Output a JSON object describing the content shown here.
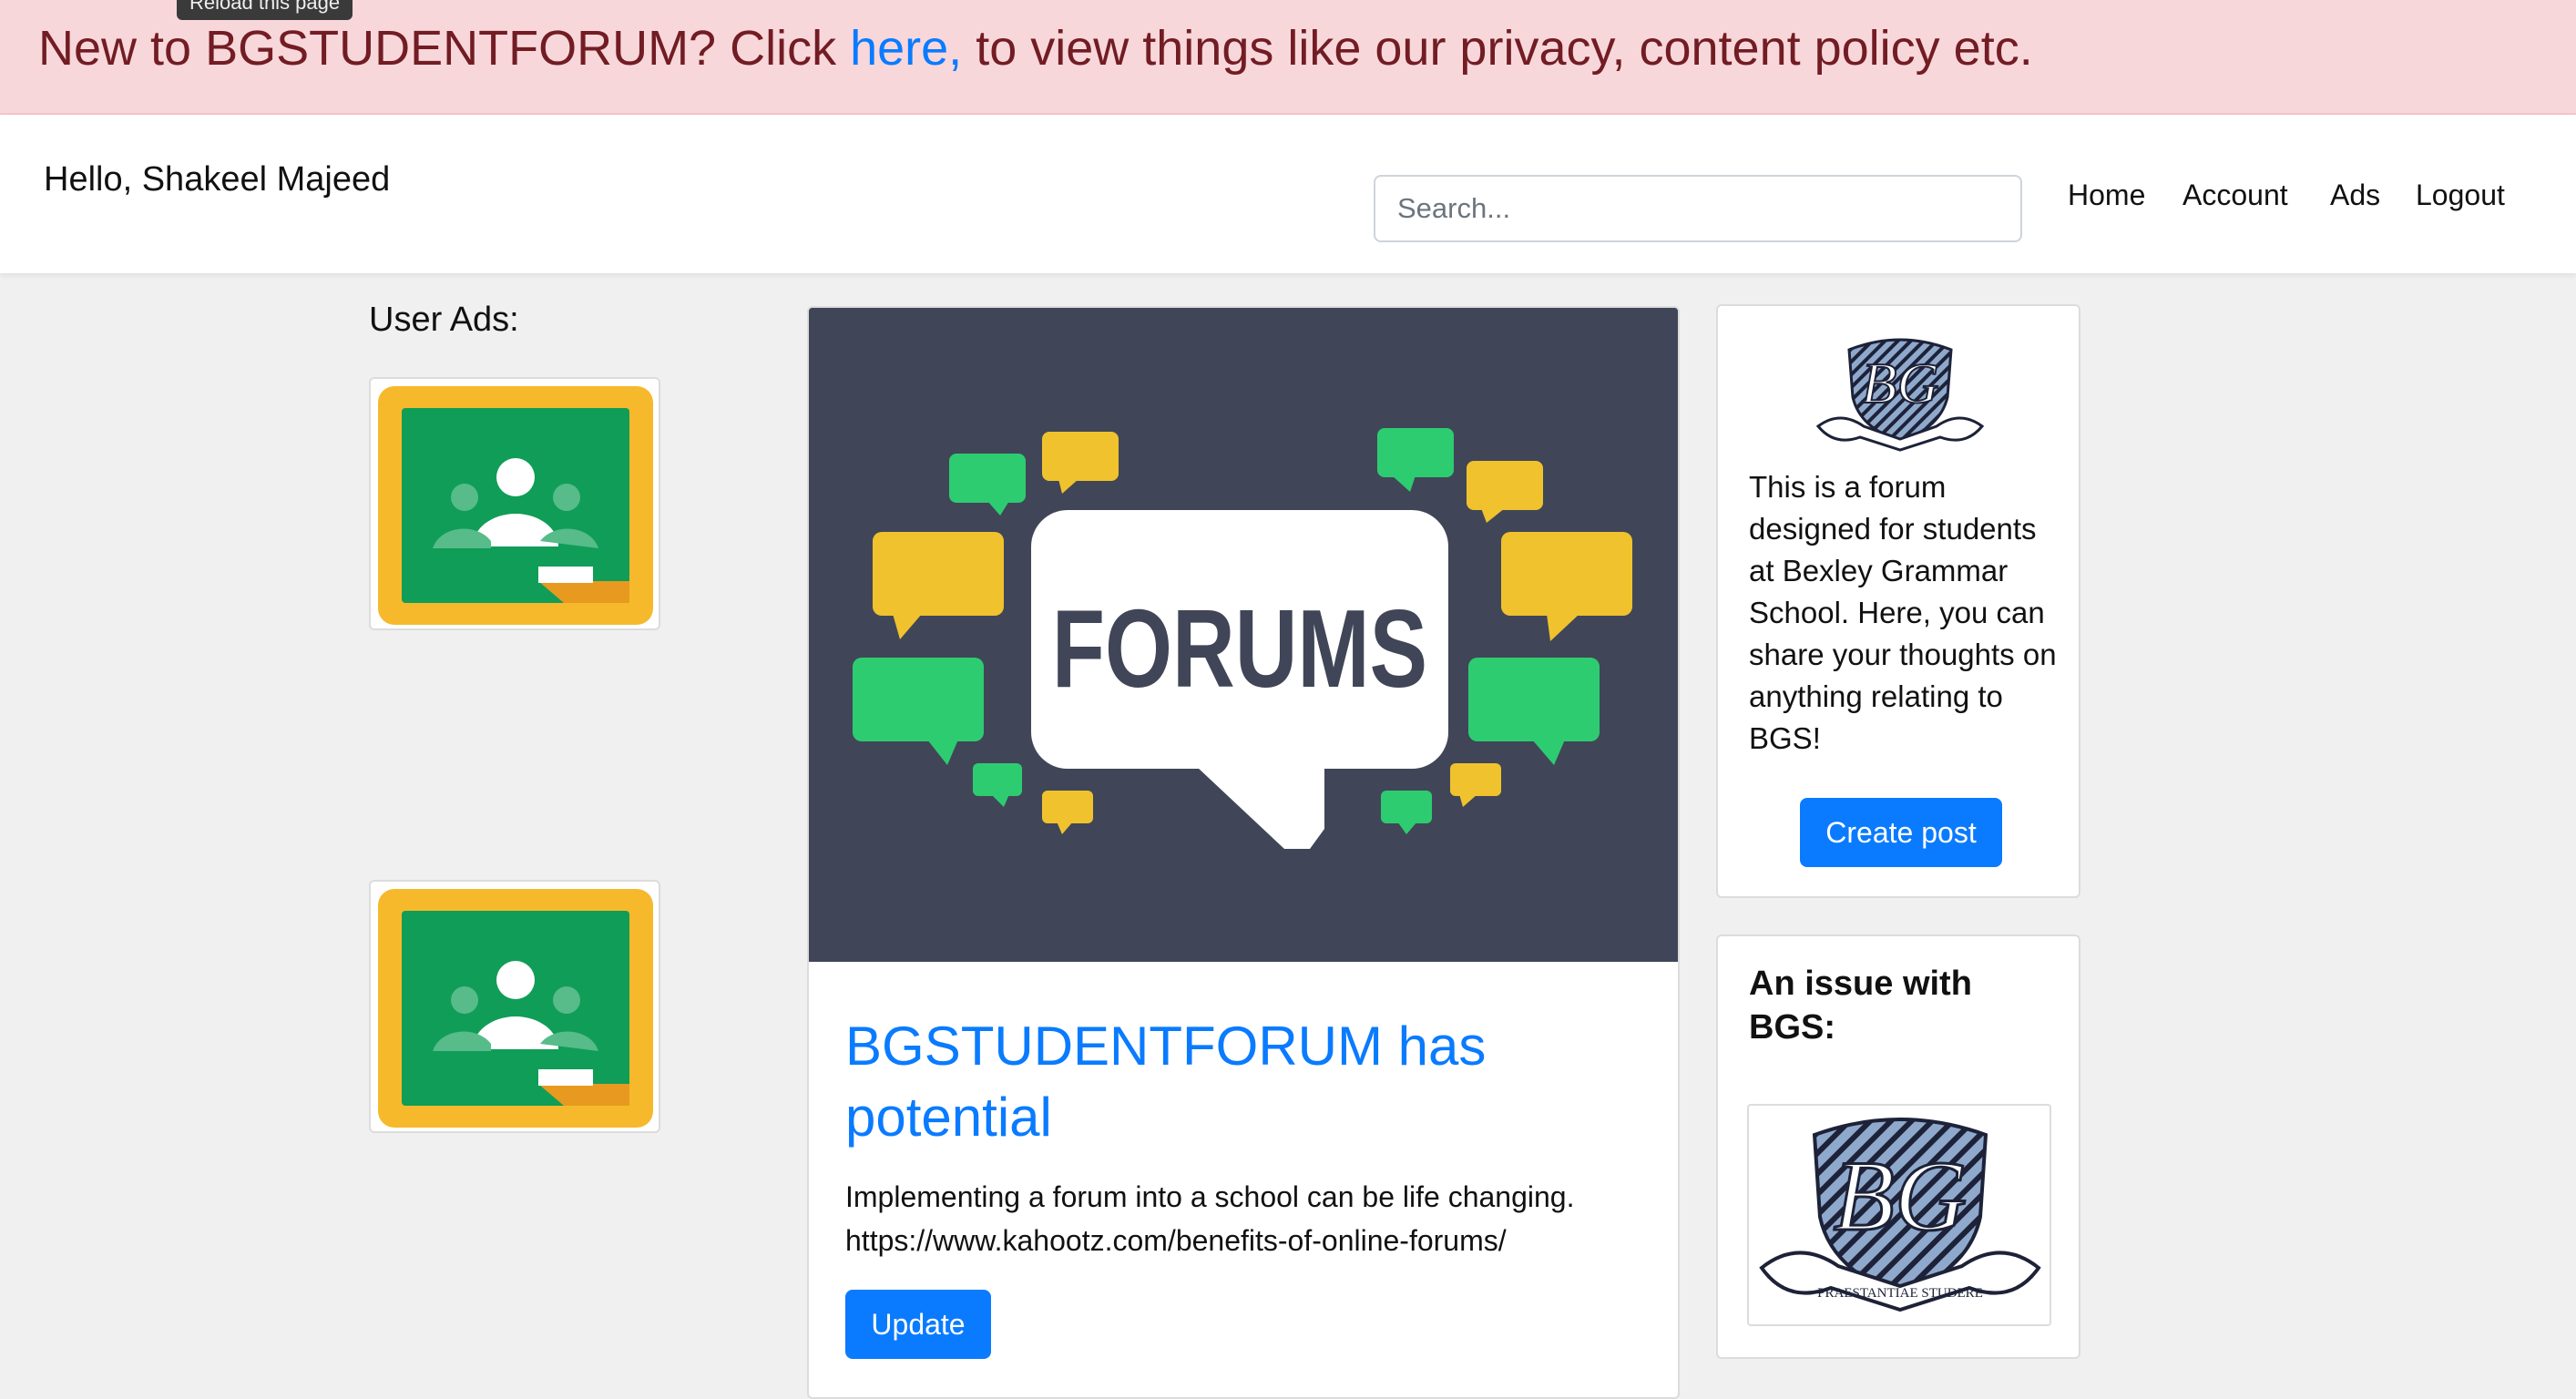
{
  "tooltip": "Reload this page",
  "alert": {
    "prefix": "New to BGSTUDENTFORUM? Click ",
    "link": "here,",
    "suffix": " to view things like our privacy, content policy etc."
  },
  "navbar": {
    "greeting": "Hello, Shakeel Majeed",
    "search_placeholder": "Search...",
    "links": [
      "Home",
      "Account",
      "Ads",
      "Logout"
    ]
  },
  "ads": {
    "title": "User Ads:",
    "items": [
      {
        "icon": "google-classroom-icon"
      },
      {
        "icon": "google-classroom-icon"
      }
    ]
  },
  "post": {
    "image_text": "FORUMS",
    "title": "BGSTUDENTFORUM has potential",
    "body_line1": "Implementing a forum into a school can be life changing.",
    "body_line2": "https://www.kahootz.com/benefits-of-online-forums/",
    "update_label": "Update"
  },
  "sidebar": {
    "about_text": "This is a forum designed for students at Bexley Grammar School. Here, you can share your thoughts on anything relating to BGS!",
    "create_label": "Create post",
    "issue_title": "An issue with BGS:",
    "crest_motto": "PRAESTANTIAE STUDERE"
  },
  "colors": {
    "alert_bg": "#f8d7da",
    "alert_text": "#721c24",
    "primary": "#0a7bff",
    "forum_bg": "#404657",
    "bubble_green": "#2ecc71",
    "bubble_yellow": "#f0c22e"
  }
}
